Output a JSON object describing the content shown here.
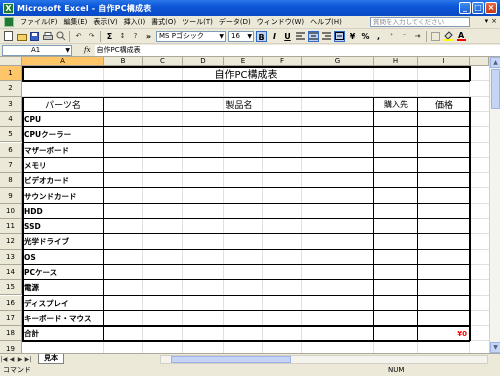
{
  "window": {
    "title": "Microsoft Excel - 自作PC構成表",
    "app_icon": "excel-icon",
    "min": "_",
    "max": "□",
    "close": "×"
  },
  "menu": {
    "items": [
      "ファイル(F)",
      "編集(E)",
      "表示(V)",
      "挿入(I)",
      "書式(O)",
      "ツール(T)",
      "データ(D)",
      "ウィンドウ(W)",
      "ヘルプ(H)"
    ],
    "help_placeholder": "質問を入力してください",
    "help_arrow": "▾",
    "doc_close": "×"
  },
  "toolbar": {
    "font_name": "MS Pゴシック",
    "font_size": "16",
    "bold": "B",
    "italic": "I",
    "underline": "U",
    "sigma": "Σ",
    "currency": "%",
    "comma": ",",
    "zoom": "»"
  },
  "formula_bar": {
    "name_box": "A1",
    "fx": "fx",
    "content": "自作PC構成表"
  },
  "columns": [
    "A",
    "B",
    "C",
    "D",
    "E",
    "F",
    "G",
    "H",
    "I"
  ],
  "rows": [
    "1",
    "2",
    "3",
    "4",
    "5",
    "6",
    "7",
    "8",
    "9",
    "10",
    "11",
    "12",
    "13",
    "14",
    "15",
    "16",
    "17",
    "18",
    "19"
  ],
  "sheet": {
    "title": "自作PC構成表",
    "headers": {
      "part": "パーツ名",
      "product": "製品名",
      "store": "購入先",
      "price": "価格"
    },
    "parts": [
      "CPU",
      "CPUクーラー",
      "マザーボード",
      "メモリ",
      "ビデオカード",
      "サウンドカード",
      "HDD",
      "SSD",
      "光学ドライブ",
      "OS",
      "PCケース",
      "電源",
      "ディスプレイ",
      "キーボード・マウス"
    ],
    "total_label": "合計",
    "total_value": "¥0",
    "total_color": "#ff0000"
  },
  "tabs": {
    "sheet_name": "見本",
    "nav": [
      "|◀",
      "◀",
      "▶",
      "▶|"
    ]
  },
  "status": {
    "mode": "コマンド",
    "num": "NUM"
  }
}
